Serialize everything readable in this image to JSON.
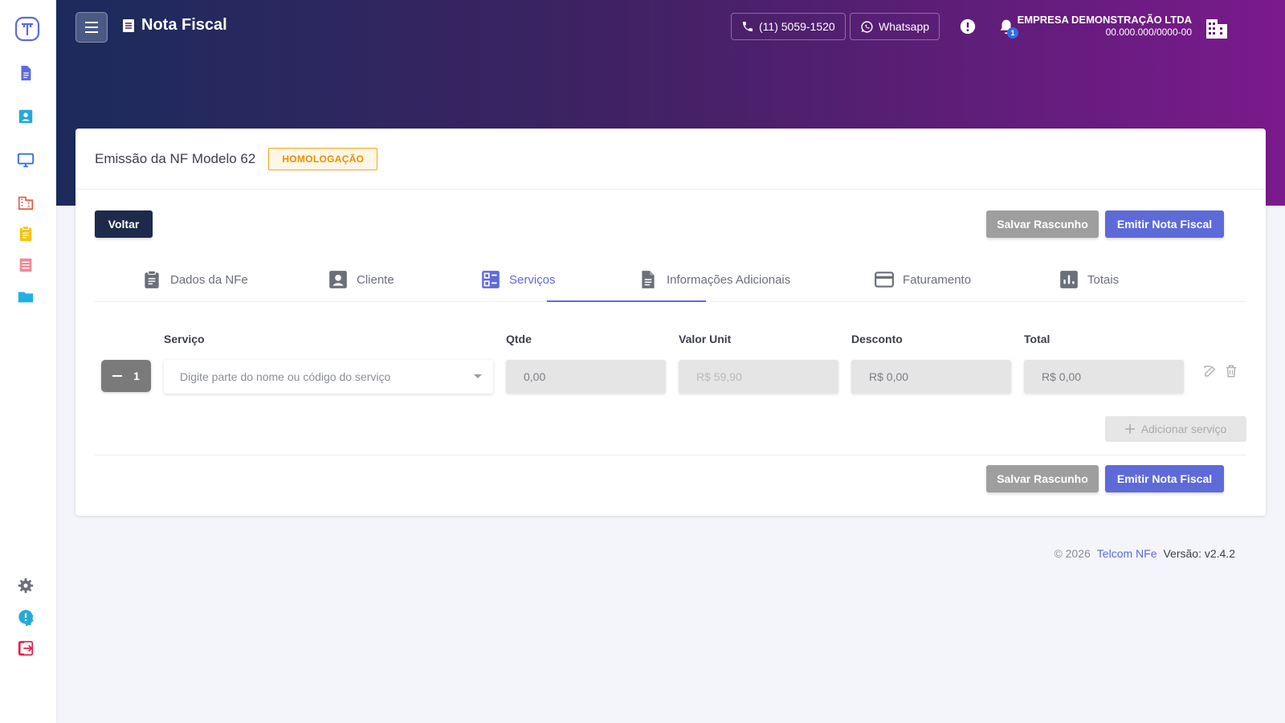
{
  "header": {
    "title": "Nota Fiscal",
    "phone_label": "(11) 5059-1520",
    "whatsapp_label": "Whatsapp",
    "notification_count": "1",
    "company_name": "EMPRESA DEMONSTRAÇÃO LTDA",
    "company_cnpj": "00.000.000/0000-00"
  },
  "card": {
    "title": "Emissão da NF Modelo 62",
    "environment_badge": "HOMOLOGAÇÃO",
    "back_label": "Voltar",
    "save_draft_label": "Salvar Rascunho",
    "emit_label": "Emitir Nota Fiscal"
  },
  "tabs": [
    {
      "label": "Dados da NFe",
      "icon": "clipboard-icon"
    },
    {
      "label": "Cliente",
      "icon": "contact-icon"
    },
    {
      "label": "Serviços",
      "icon": "services-icon",
      "active": true
    },
    {
      "label": "Informações Adicionais",
      "icon": "document-icon"
    },
    {
      "label": "Faturamento",
      "icon": "credit-card-icon"
    },
    {
      "label": "Totais",
      "icon": "bar-chart-icon"
    }
  ],
  "services": {
    "columns": {
      "service": "Serviço",
      "qty": "Qtde",
      "unit_value": "Valor Unit",
      "discount": "Desconto",
      "total": "Total"
    },
    "row": {
      "index": "1",
      "service_placeholder": "Digite parte do nome ou código do serviço",
      "qty": "0,00",
      "unit_value": "R$ 59,90",
      "discount": "R$ 0,00",
      "total": "R$ 0,00"
    },
    "add_label": "Adicionar serviço"
  },
  "footer": {
    "copyright": "© 2026",
    "brand": "Telcom NFe",
    "version": "Versão: v2.4.2"
  },
  "colors": {
    "accent": "#5e6ad8",
    "dark_button": "#1d2a4c",
    "warning": "#f08c00"
  }
}
